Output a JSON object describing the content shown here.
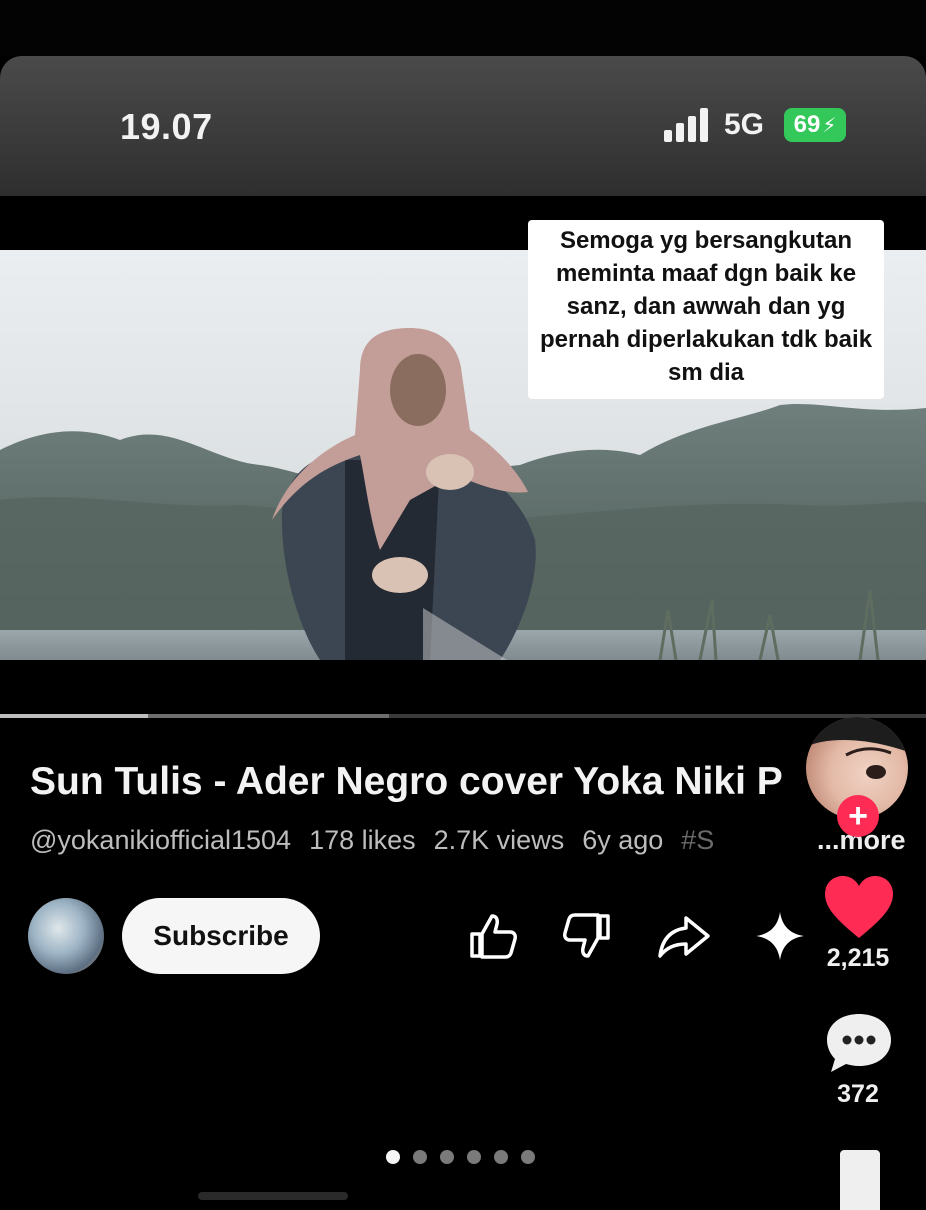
{
  "status_bar": {
    "time": "19.07",
    "network": "5G",
    "battery_level": "69",
    "battery_color": "#34c759"
  },
  "video": {
    "caption": "Semoga yg bersangkutan meminta maaf dgn baik ke sanz, dan awwah dan yg pernah diperlakukan tdk baik sm dia",
    "playback_progress": 0.16,
    "buffered_progress": 0.42
  },
  "info": {
    "title": "Sun Tulis - Ader Negro cover Yoka Niki P",
    "channel": "@yokanikiofficial1504",
    "likes": "178 likes",
    "views": "2.7K views",
    "age": "6y ago",
    "hashtag": "#S",
    "more": "...more"
  },
  "actions": {
    "subscribe_label": "Subscribe",
    "icons": [
      "thumbs-up-icon",
      "thumbs-down-icon",
      "share-icon",
      "sparkle-icon"
    ]
  },
  "tiktok_sidebar": {
    "follow_symbol": "+",
    "like_count": "2,215",
    "comment_count": "372",
    "accent_color": "#fe2c55"
  },
  "carousel": {
    "count": 6,
    "active_index": 0
  }
}
